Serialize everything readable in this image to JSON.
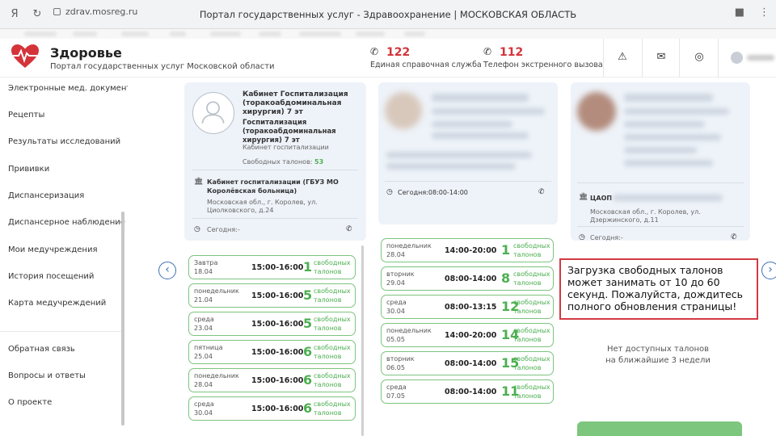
{
  "browser": {
    "url": "zdrav.mosreg.ru",
    "tab_title": "Портал государственных услуг - Здравоохранение | МОСКОВСКАЯ ОБЛАСТЬ"
  },
  "header": {
    "brand_title": "Здоровье",
    "brand_subtitle": "Портал государственных услуг Московской области",
    "phones": [
      {
        "number": "122",
        "label": "Единая справочная служба"
      },
      {
        "number": "112",
        "label": "Телефон экстренного вызова"
      }
    ],
    "colors": {
      "brand_red": "#d4333a",
      "accent_blue": "#3b6fb6",
      "green": "#4caf50"
    }
  },
  "sidebar": {
    "items": [
      {
        "label": "Электронные мед. документы"
      },
      {
        "label": "Рецепты"
      },
      {
        "label": "Результаты исследований"
      },
      {
        "label": "Прививки"
      },
      {
        "label": "Диспансеризация"
      },
      {
        "label": "Диспансерное наблюдение"
      },
      {
        "label": "Мои медучреждения"
      },
      {
        "label": "История посещений"
      },
      {
        "label": "Карта медучреждений"
      },
      {
        "label": "Обратная связь"
      },
      {
        "label": "Вопросы и ответы"
      },
      {
        "label": "О проекте"
      }
    ]
  },
  "card1": {
    "title": "Кабинет Госпитализация (торакоабдоминальная хирургия) 7 эт",
    "subtitle": "Госпитализация (торакоабдоминальная хирургия) 7 эт",
    "type": "Кабинет госпитализации",
    "free_label": "Свободных талонов:",
    "free_count": "53",
    "org": "Кабинет госпитализации (ГБУЗ МО Королёвская больница)",
    "address": "Московская обл., г. Королев, ул. Циолковского, д.24",
    "today": "Сегодня:-",
    "slots": [
      {
        "day": "Завтра",
        "date": "18.04",
        "time": "15:00-16:00",
        "count": "1"
      },
      {
        "day": "понедельник",
        "date": "21.04",
        "time": "15:00-16:00",
        "count": "5"
      },
      {
        "day": "среда",
        "date": "23.04",
        "time": "15:00-16:00",
        "count": "5"
      },
      {
        "day": "пятница",
        "date": "25.04",
        "time": "15:00-16:00",
        "count": "6"
      },
      {
        "day": "понедельник",
        "date": "28.04",
        "time": "15:00-16:00",
        "count": "6"
      },
      {
        "day": "среда",
        "date": "30.04",
        "time": "15:00-16:00",
        "count": "6"
      }
    ]
  },
  "card2": {
    "today": "Сегодня:08:00-14:00",
    "slots": [
      {
        "day": "понедельник",
        "date": "28.04",
        "time": "14:00-20:00",
        "count": "1"
      },
      {
        "day": "вторник",
        "date": "29.04",
        "time": "08:00-14:00",
        "count": "8"
      },
      {
        "day": "среда",
        "date": "30.04",
        "time": "08:00-13:15",
        "count": "12"
      },
      {
        "day": "понедельник",
        "date": "05.05",
        "time": "14:00-20:00",
        "count": "14"
      },
      {
        "day": "вторник",
        "date": "06.05",
        "time": "08:00-14:00",
        "count": "15"
      },
      {
        "day": "среда",
        "date": "07.05",
        "time": "08:00-14:00",
        "count": "11"
      }
    ]
  },
  "card3": {
    "org_prefix": "ЦАОП",
    "address": "Московская обл., г. Королев, ул. Дзержинского, д.11",
    "today": "Сегодня:-",
    "no_slots_line1": "Нет доступных талонов",
    "no_slots_line2": "на ближайшие 3 недели"
  },
  "slot_label_line1": "свободных",
  "slot_label_line2": "талонов",
  "notice": {
    "text": "Загрузка свободных талонов может занимать от 10 до 60 секунд. Пожалуйста, дождитесь полного обновления страницы!"
  }
}
